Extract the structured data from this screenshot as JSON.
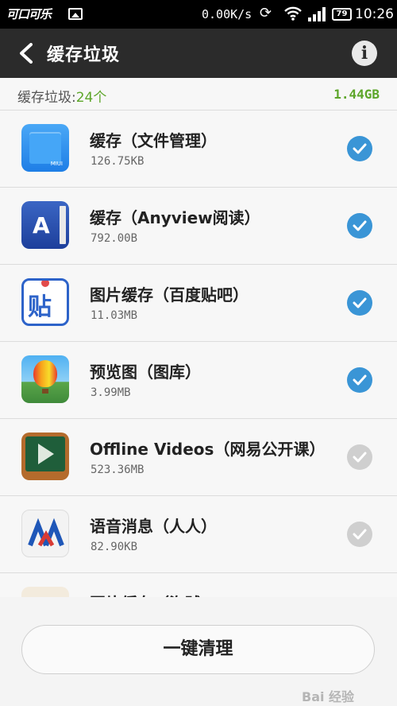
{
  "status_bar": {
    "logo": "可口可乐",
    "net_speed": "0.00K/s",
    "battery": "79",
    "time": "10:26"
  },
  "header": {
    "title": "缓存垃圾"
  },
  "summary": {
    "label": "缓存垃圾:",
    "count": "24个",
    "total_size": "1.44GB"
  },
  "items": [
    {
      "name": "缓存（文件管理）",
      "size": "126.75KB",
      "checked": true,
      "icon": "file-manager-icon"
    },
    {
      "name": "缓存（Anyview阅读）",
      "size": "792.00B",
      "checked": true,
      "icon": "anyview-reader-icon"
    },
    {
      "name": "图片缓存（百度贴吧）",
      "size": "11.03MB",
      "checked": true,
      "icon": "baidu-tieba-icon"
    },
    {
      "name": "预览图（图库）",
      "size": "3.99MB",
      "checked": true,
      "icon": "gallery-icon"
    },
    {
      "name": "Offline Videos（网易公开课）",
      "size": "523.36MB",
      "checked": false,
      "icon": "netease-open-course-icon"
    },
    {
      "name": "语音消息（人人）",
      "size": "82.90KB",
      "checked": false,
      "icon": "renren-icon"
    },
    {
      "name": "图片缓存（海贼",
      "size": "",
      "checked": false,
      "icon": "partial-app-icon"
    }
  ],
  "icon_glyphs": {
    "tieba": "贴",
    "anyview": "A",
    "folder_badge": "MIUI"
  },
  "actions": {
    "clean_label": "一键清理"
  },
  "watermark": "Bai 经验",
  "colors": {
    "accent_green": "#5da62a",
    "check_blue": "#3a95d6",
    "check_gray": "#cfcfcf",
    "titlebar": "#2b2b2b"
  }
}
